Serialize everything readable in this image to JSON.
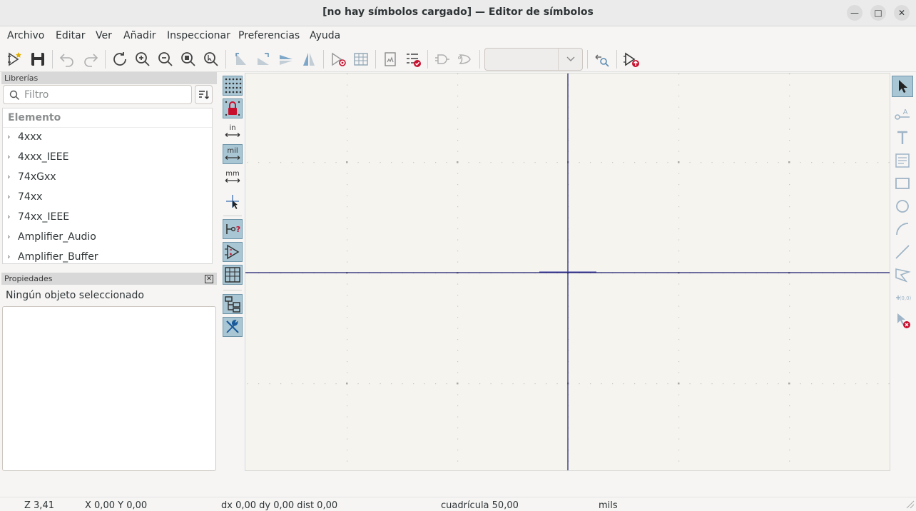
{
  "window": {
    "title": "[no hay símbolos cargado] — Editor de símbolos",
    "minimize_glyph": "—",
    "maximize_glyph": "□",
    "close_glyph": "✕"
  },
  "menu": {
    "items": [
      "Archivo",
      "Editar",
      "Ver",
      "Añadir",
      "Inspeccionar",
      "Preferencias",
      "Ayuda"
    ]
  },
  "toolbar": {
    "unit_combo_value": "",
    "icons": [
      "new-symbol-icon",
      "save-icon",
      "undo-icon",
      "redo-icon",
      "refresh-icon",
      "zoom-in-icon",
      "zoom-out-icon",
      "zoom-fit-icon",
      "zoom-to-objects-icon",
      "rotate-ccw-icon",
      "rotate-cw-icon",
      "mirror-v-icon",
      "mirror-h-icon",
      "symbol-properties-icon",
      "pin-table-icon",
      "datasheet-icon",
      "symbol-checker-icon",
      "show-deMorgan-normal-icon",
      "show-deMorgan-alt-icon",
      "search-navigate-icon",
      "add-to-schematic-icon"
    ]
  },
  "libraries": {
    "panel_title": "Librerías",
    "filter_placeholder": "Filtro",
    "column_header": "Elemento",
    "items": [
      "4xxx",
      "4xxx_IEEE",
      "74xGxx",
      "74xx",
      "74xx_IEEE",
      "Amplifier_Audio",
      "Amplifier_Buffer"
    ]
  },
  "properties": {
    "panel_title": "Propiedades",
    "empty_message": "Ningún objeto seleccionado"
  },
  "left_tools": {
    "inch_label": "in",
    "mil_label": "mil",
    "mm_label": "mm"
  },
  "status": {
    "zoom": "Z 3,41",
    "coords": "X 0,00  Y 0,00",
    "delta": "dx 0,00  dy 0,00  dist 0,00",
    "grid": "cuadrícula 50,00",
    "units": "mils"
  },
  "colors": {
    "canvas_bg": "#f5f4ef",
    "axis": "#1a1a6e",
    "active_tool": "#a9c6d4",
    "accent_red": "#c8102e"
  }
}
